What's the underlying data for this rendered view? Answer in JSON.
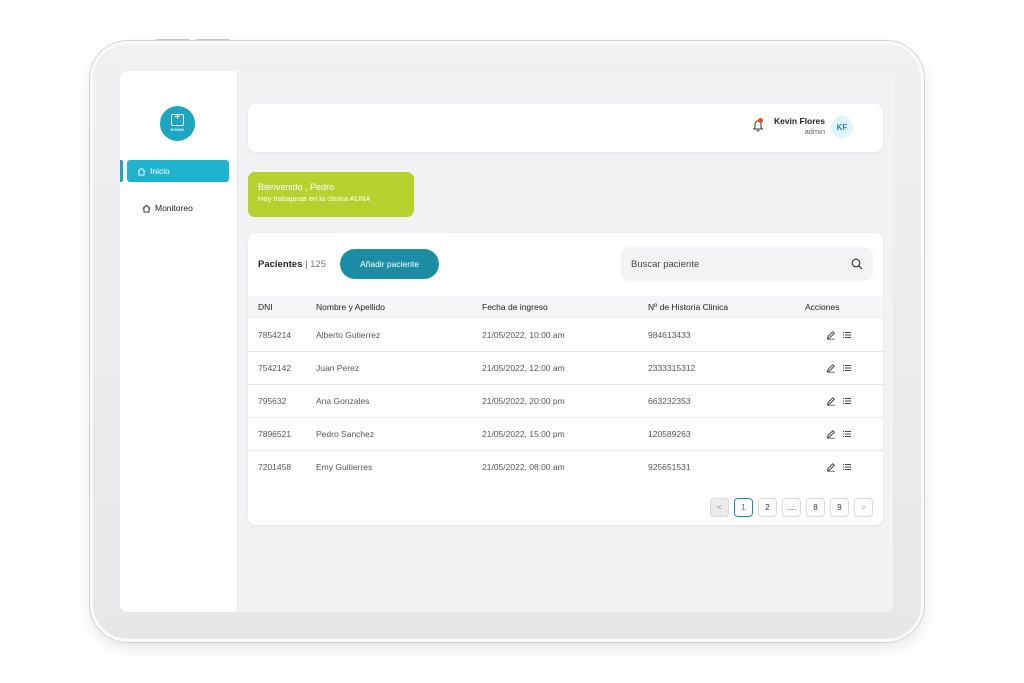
{
  "sidebar": {
    "logo_text": "HOME",
    "items": [
      {
        "label": "Inicio",
        "icon": "home-icon",
        "active": true
      },
      {
        "label": "Monitoreo",
        "icon": "home-icon",
        "active": false
      }
    ]
  },
  "header": {
    "user_name": "Kevin Flores",
    "user_role": "admin",
    "avatar_initials": "KF",
    "notification_icon": "bell-icon"
  },
  "welcome": {
    "line1": "Bienvenido , Pedro",
    "line2": "Hoy trabajaras en la clinica AUNA"
  },
  "patients": {
    "title": "Pacientes",
    "separator": "|",
    "count": "125",
    "add_button": "Añadir paciente",
    "search_placeholder": "Buscar paciente",
    "columns": [
      "DNI",
      "Nombre y Apellido",
      "Fecha de ingreso",
      "Nº de Historia Clinica",
      "Acciones"
    ],
    "rows": [
      {
        "dni": "7854214",
        "name": "Alberto Gutierrez",
        "date": "21/05/2022, 10:00 am",
        "history": "984613433"
      },
      {
        "dni": "7542142",
        "name": "Juan Perez",
        "date": "21/05/2022, 12:00 am",
        "history": "2333315312"
      },
      {
        "dni": "795632",
        "name": "Ana Gonzales",
        "date": "21/05/2022, 20:00 pm",
        "history": "663232353"
      },
      {
        "dni": "7896521",
        "name": "Pedro Sanchez",
        "date": "21/05/2022, 15:00 pm",
        "history": "120589263"
      },
      {
        "dni": "7201458",
        "name": "Emy Guitierres",
        "date": "21/05/2022, 08:00 am",
        "history": "925651531"
      }
    ]
  },
  "pagination": {
    "prev": "<",
    "pages": [
      "1",
      "2",
      "....",
      "8",
      "9"
    ],
    "current": "1",
    "next": ">"
  },
  "colors": {
    "accent": "#1fb3cf",
    "button": "#1b8ea6",
    "welcome_bg": "#b8d12e",
    "notification_dot": "#e8501f"
  }
}
